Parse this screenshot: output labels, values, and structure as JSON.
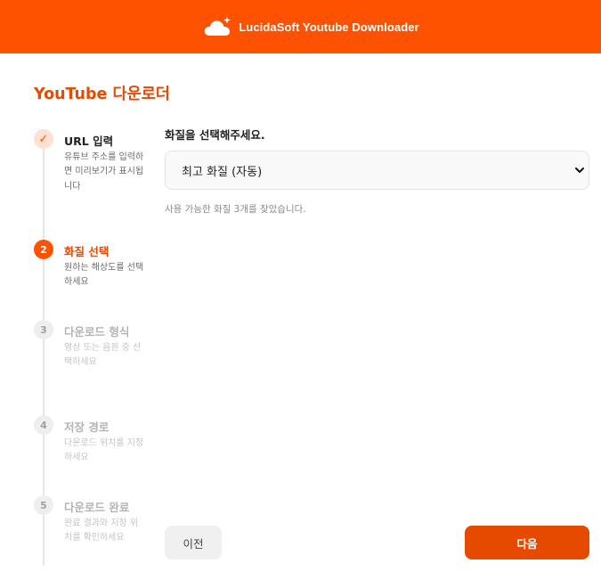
{
  "header": {
    "icon": "cloud-sparkle-icon",
    "title": "LucidaSoft Youtube Downloader",
    "color": "#ff5200"
  },
  "page_title": "YouTube 다운로더",
  "steps": [
    {
      "marker": "✓",
      "title": "URL 입력",
      "desc": "유튜브 주소를 입력하면 미리보기가 표시됩니다",
      "state": "done"
    },
    {
      "marker": "2",
      "title": "화질 선택",
      "desc": "원하는 해상도를 선택하세요",
      "state": "active"
    },
    {
      "marker": "3",
      "title": "다운로드 형식",
      "desc": "영상 또는 음원 중 선택하세요",
      "state": "pending"
    },
    {
      "marker": "4",
      "title": "저장 경로",
      "desc": "다운로드 위치를 지정하세요",
      "state": "pending"
    },
    {
      "marker": "5",
      "title": "다운로드 완료",
      "desc": "완료 결과와 저장 위치를 확인하세요",
      "state": "pending"
    }
  ],
  "quality": {
    "label": "화질을 선택해주세요.",
    "selected": "최고 화질 (자동)",
    "help": "사용 가능한 화질 3개를 찾았습니다."
  },
  "buttons": {
    "prev": "이전",
    "next": "다음"
  },
  "colors": {
    "accent": "#ff5200",
    "accent_dark": "#e64a00"
  }
}
